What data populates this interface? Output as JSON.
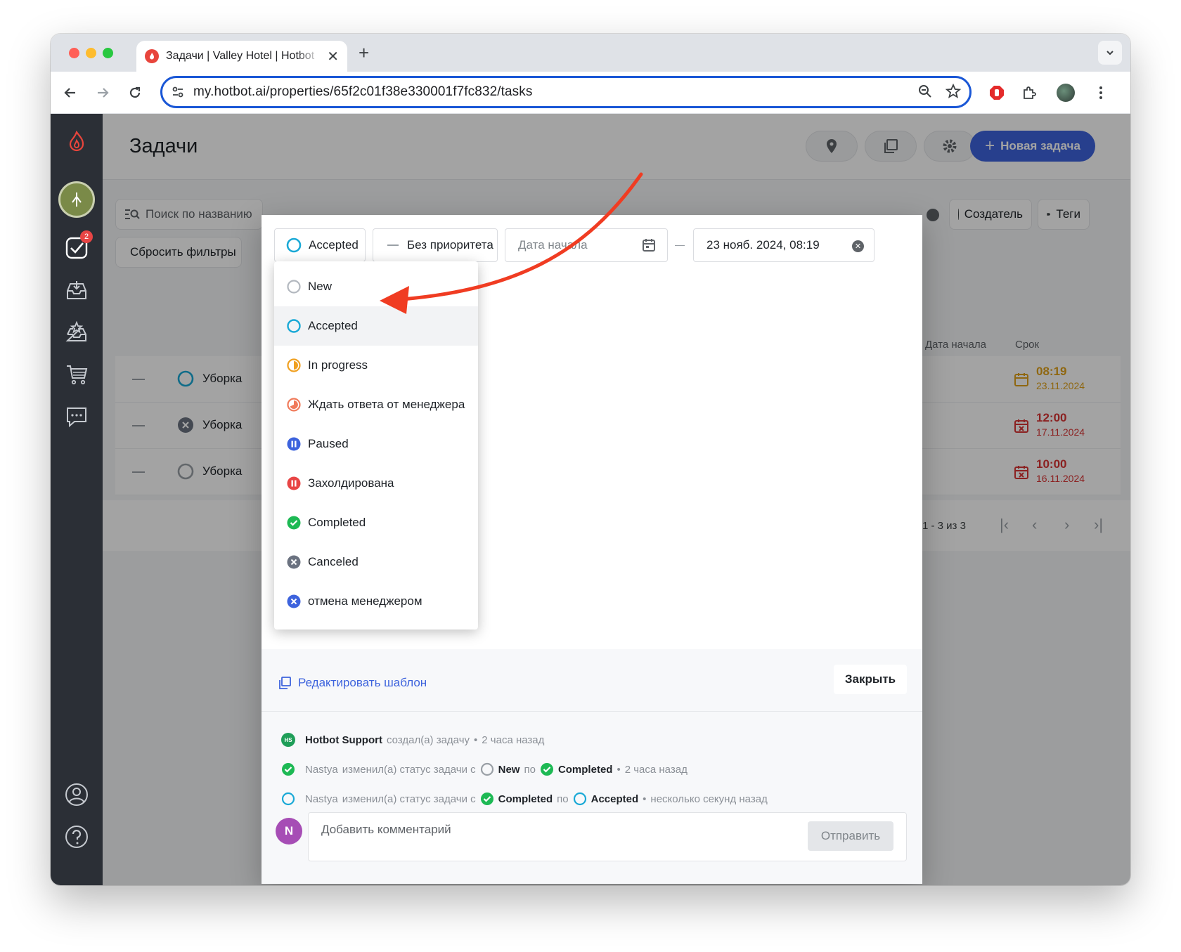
{
  "browser": {
    "tab_title": "Задачи | Valley Hotel | Hotbot",
    "url": "my.hotbot.ai/properties/65f2c01f38e330001f7fc832/tasks"
  },
  "sidebar": {
    "badge_count": "2"
  },
  "header": {
    "title": "Задачи",
    "new_task_label": "Новая задача"
  },
  "filters": {
    "search_placeholder": "Поиск по названию",
    "reset_label": "Сбросить фильтры",
    "creator_label": "Создатель",
    "tags_label": "Теги"
  },
  "table": {
    "col_start": "Дата начала",
    "col_due": "Срок",
    "rows": [
      {
        "name": "Уборка",
        "time": "08:19",
        "date": "23.11.2024",
        "status": "accepted",
        "due_color": "#e0a21b"
      },
      {
        "name": "Уборка",
        "time": "12:00",
        "date": "17.11.2024",
        "status": "canceled",
        "due_color": "#d93434"
      },
      {
        "name": "Уборка",
        "time": "10:00",
        "date": "16.11.2024",
        "status": "new",
        "due_color": "#d93434"
      }
    ],
    "pagination": "1 - 3 из 3"
  },
  "dialog": {
    "status_value": "Accepted",
    "priority_value": "Без приоритета",
    "start_placeholder": "Дата начала",
    "due_value": "23 нояб. 2024, 08:19",
    "edit_template_label": "Редактировать шаблон",
    "close_label": "Закрыть",
    "status_options": [
      {
        "label": "New",
        "icon": "status-new-icon"
      },
      {
        "label": "Accepted",
        "icon": "status-accepted-icon"
      },
      {
        "label": "In progress",
        "icon": "status-in-progress-icon"
      },
      {
        "label": "Ждать ответа от менеджера",
        "icon": "status-waiting-icon"
      },
      {
        "label": "Paused",
        "icon": "status-paused-icon"
      },
      {
        "label": "Захолдирована",
        "icon": "status-on-hold-icon"
      },
      {
        "label": "Completed",
        "icon": "status-completed-icon"
      },
      {
        "label": "Canceled",
        "icon": "status-canceled-icon"
      },
      {
        "label": "отмена менеджером",
        "icon": "status-manager-canceled-icon"
      }
    ],
    "activity": [
      {
        "actor": "Hotbot Support",
        "text": "создал(а) задачу",
        "time": "2 часа назад"
      },
      {
        "actor": "Nastya",
        "text": "изменил(а) статус задачи с",
        "from": "New",
        "by": "по",
        "to": "Completed",
        "time": "2 часа назад"
      },
      {
        "actor": "Nastya",
        "text": "изменил(а) статус задачи с",
        "from": "Completed",
        "by": "по",
        "to": "Accepted",
        "time": "несколько секунд назад"
      }
    ],
    "avatar_initials": "HS",
    "comment_avatar": "N",
    "comment_placeholder": "Добавить комментарий",
    "send_label": "Отправить"
  },
  "colors": {
    "accent": "#3d63dd",
    "sidebar": "#2b2f36",
    "accepted": "#1aa9d6",
    "in_progress": "#f0a020",
    "waiting": "#f07a5a",
    "paused": "#3d63dd",
    "on_hold": "#e84545",
    "completed": "#1db954",
    "canceled": "#6b7280",
    "annotation_arrow": "#f03c22"
  }
}
